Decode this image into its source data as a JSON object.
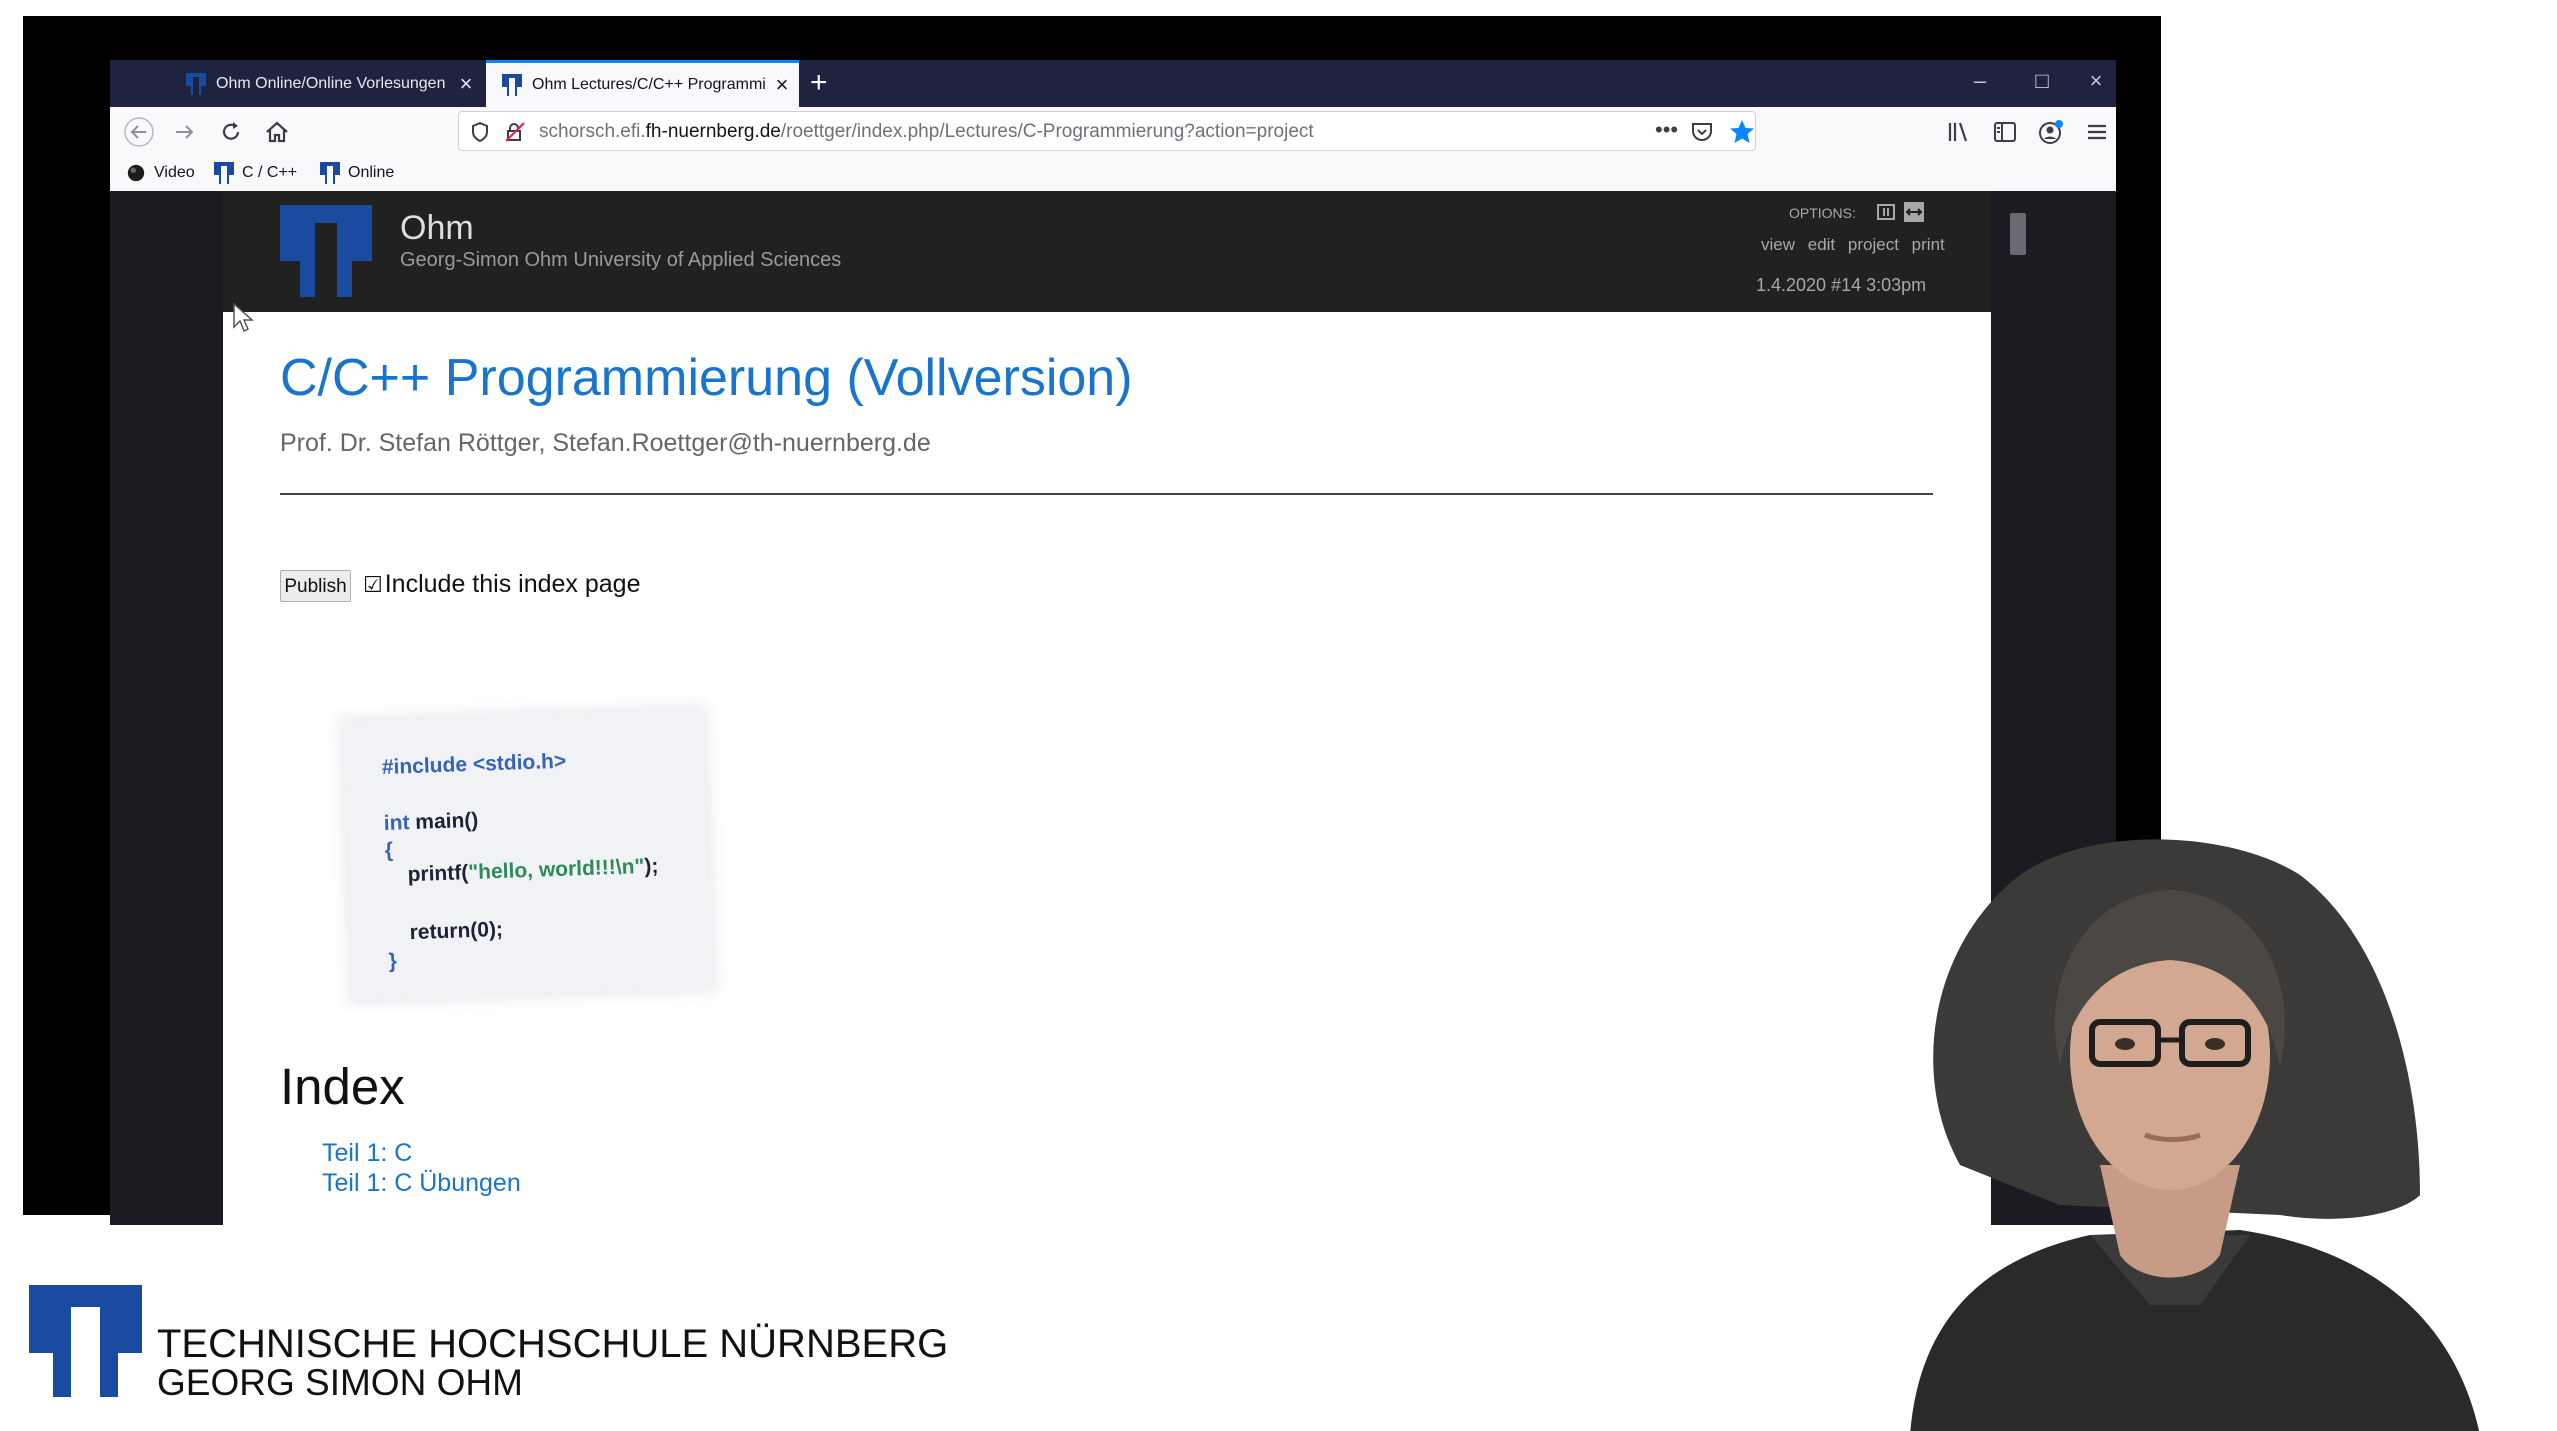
{
  "browser": {
    "tabs": [
      {
        "title": "Ohm Online/Online Vorlesungen",
        "active": false
      },
      {
        "title": "Ohm Lectures/C/C++ Programmierung",
        "active": true
      }
    ],
    "new_tab_label": "+",
    "url": {
      "prefix": "schorsch.efi.",
      "domain": "fh-nuernberg.de",
      "path": "/roettger/index.php/Lectures/C-Programmierung?action=project"
    },
    "bookmarks": [
      {
        "label": "Video",
        "icon": "video-dot-icon"
      },
      {
        "label": "C / C++",
        "icon": "ohm-logo-icon"
      },
      {
        "label": "Online",
        "icon": "ohm-logo-icon"
      }
    ],
    "accent_color": "#0a84ff"
  },
  "site": {
    "name": "Ohm",
    "subtitle": "Georg-Simon Ohm University of Applied Sciences",
    "options_label": "OPTIONS:",
    "option_links": [
      "view",
      "edit",
      "project",
      "print"
    ],
    "date": "1.4.2020 #14 3:03pm"
  },
  "page": {
    "title": "C/C++ Programmierung (Vollversion)",
    "author": "Prof. Dr. Stefan Röttger, Stefan.Roettger@th-nuernberg.de",
    "publish_label": "Publish",
    "checkbox_glyph": "☑",
    "include_label": "Include this index page",
    "code": {
      "include_kw": "#include",
      "include_hdr": " <stdio.h>",
      "int_kw": "int",
      "main_sig": " main()",
      "open_brace": "{",
      "printf_fn": "printf(",
      "printf_str": "\"hello, world!!!\\n\"",
      "printf_end": ");",
      "return_kw": "return",
      "return_val": "(0);",
      "close_brace": "}"
    },
    "index_heading": "Index",
    "index_items": [
      "Teil 1: C",
      "Teil 1: C Übungen"
    ],
    "link_color": "#1874cd"
  },
  "footer": {
    "university_line1": "TECHNISCHE HOCHSCHULE NÜRNBERG",
    "university_line2": "GEORG SIMON OHM",
    "brand_color": "#1a4ba0"
  }
}
